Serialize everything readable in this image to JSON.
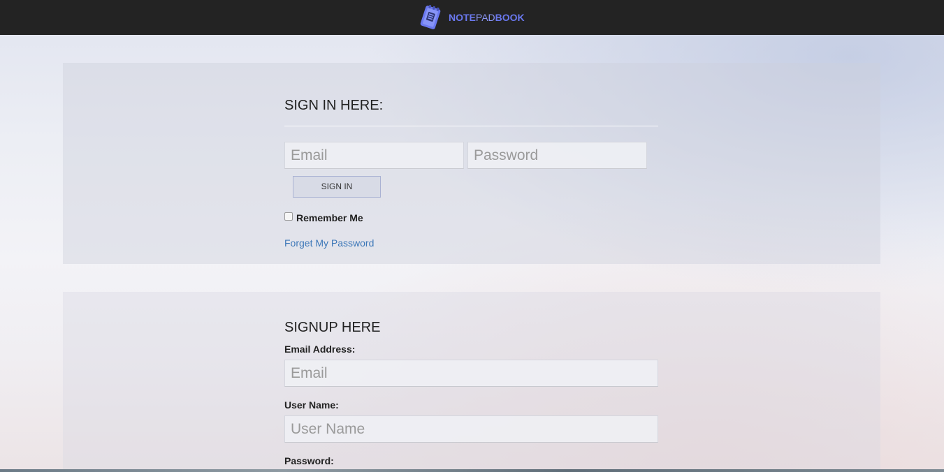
{
  "header": {
    "brand_note": "NOTE",
    "brand_pad": "PAD",
    "brand_book": "BOOK",
    "logo_icon": "notepad-icon",
    "brand_color": "#6a78ef"
  },
  "signin": {
    "title": "SIGN IN HERE:",
    "email_placeholder": "Email",
    "password_placeholder": "Password",
    "button_label": "SIGN IN",
    "remember_label": "Remember Me",
    "forgot_label": "Forget My Password"
  },
  "signup": {
    "title": "SIGNUP HERE",
    "email_label": "Email Address:",
    "email_placeholder": "Email",
    "username_label": "User Name:",
    "username_placeholder": "User Name",
    "password_label": "Password:"
  },
  "colors": {
    "topbar": "#232323",
    "link": "#3d78b8"
  }
}
